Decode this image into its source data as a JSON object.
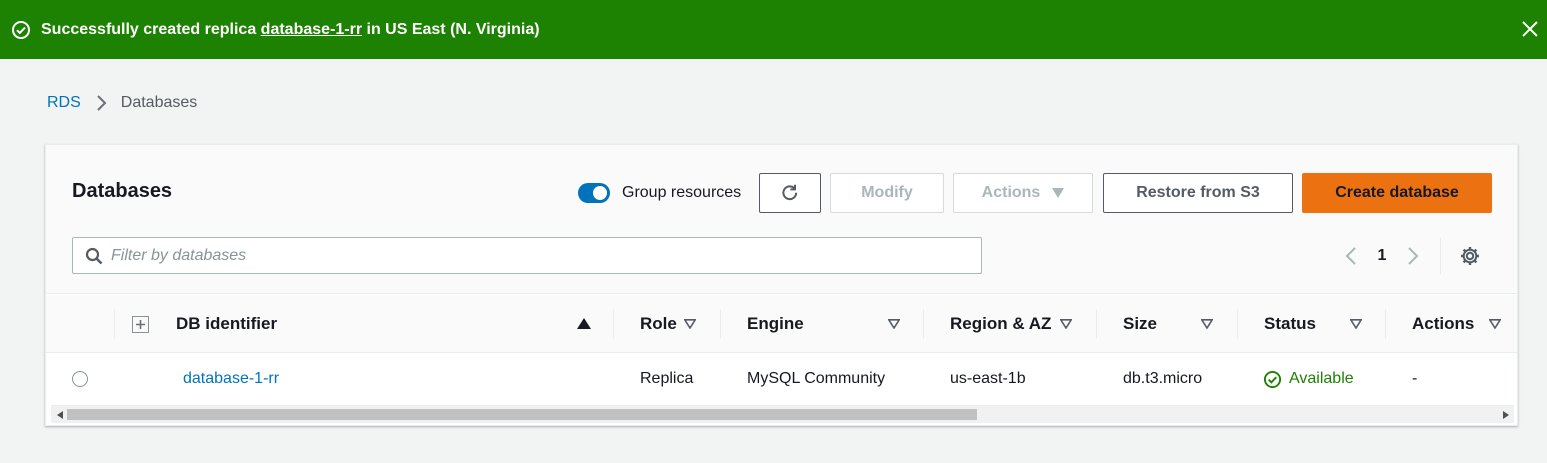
{
  "flash": {
    "prefix": "Successfully created replica ",
    "link": "database-1-rr",
    "suffix": " in US East (N. Virginia)",
    "color": "#1d8102"
  },
  "breadcrumb": {
    "root": "RDS",
    "current": "Databases"
  },
  "panel": {
    "title": "Databases",
    "group_toggle_label": "Group resources",
    "group_toggle_on": true,
    "buttons": {
      "modify": "Modify",
      "actions": "Actions",
      "restore": "Restore from S3",
      "create": "Create database"
    },
    "filter_placeholder": "Filter by databases",
    "page_number": "1"
  },
  "table": {
    "columns": [
      "DB identifier",
      "Role",
      "Engine",
      "Region & AZ",
      "Size",
      "Status",
      "Actions"
    ],
    "rows": [
      {
        "identifier": "database-1-rr",
        "role": "Replica",
        "engine": "MySQL Community",
        "region_az": "us-east-1b",
        "size": "db.t3.micro",
        "status": "Available",
        "actions": "-"
      }
    ]
  },
  "colors": {
    "accent": "#0073bb",
    "primary_button": "#ec7211",
    "success": "#1d8102"
  }
}
